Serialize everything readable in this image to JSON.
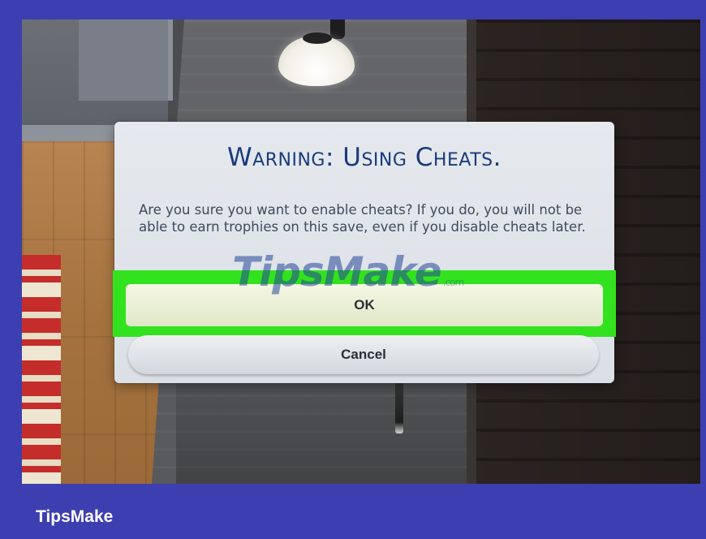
{
  "dialog": {
    "title": "Warning: Using Cheats.",
    "message": "Are you sure you want to enable cheats?  If you do, you will not be able to earn trophies on this save, even if you disable cheats later.",
    "ok_label": "OK",
    "cancel_label": "Cancel"
  },
  "watermark": {
    "text": "TipsMake",
    "suffix": ".com"
  },
  "footer": {
    "brand": "TipsMake"
  },
  "colors": {
    "frame": "#3d3fb1",
    "highlight": "#33e21f",
    "title": "#1a3b7a"
  }
}
